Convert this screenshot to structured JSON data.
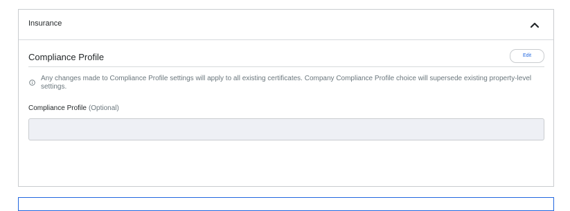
{
  "panel": {
    "title": "Insurance",
    "collapse_icon": "chevron-up-icon"
  },
  "section": {
    "title": "Compliance Profile",
    "edit_label": "Edit",
    "info_icon": "info-circle-icon",
    "info_text": "Any changes made to Compliance Profile settings will apply to all existing certificates. Company Compliance Profile choice will supersede existing property-level settings."
  },
  "field": {
    "label": "Compliance Profile",
    "optional_label": "(Optional)",
    "value": ""
  },
  "colors": {
    "accent": "#2066df",
    "input_bg": "#eef0f5",
    "border": "#c9cccf"
  }
}
